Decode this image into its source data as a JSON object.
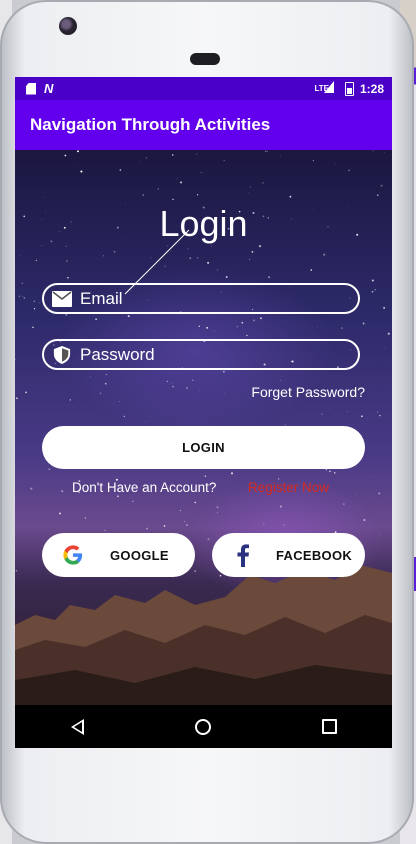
{
  "statusbar": {
    "time": "1:28",
    "network": "LTE"
  },
  "appbar": {
    "title": "Navigation Through Activities"
  },
  "login": {
    "title": "Login",
    "email_placeholder": "Email",
    "password_placeholder": "Password",
    "forget_password": "Forget Password?",
    "login_button": "LOGIN",
    "no_account": "Don't Have an Account?",
    "register_now": "Register Now"
  },
  "social": {
    "google_label": "GOOGLE",
    "facebook_label": "FACEBOOK"
  },
  "icons": {
    "email": "email-icon",
    "password": "shield-icon",
    "google": "google-icon",
    "facebook": "facebook-icon"
  },
  "colors": {
    "statusbar": "#4a00c6",
    "appbar": "#6200ee",
    "register": "#d72a1e",
    "facebook": "#2b3280"
  }
}
